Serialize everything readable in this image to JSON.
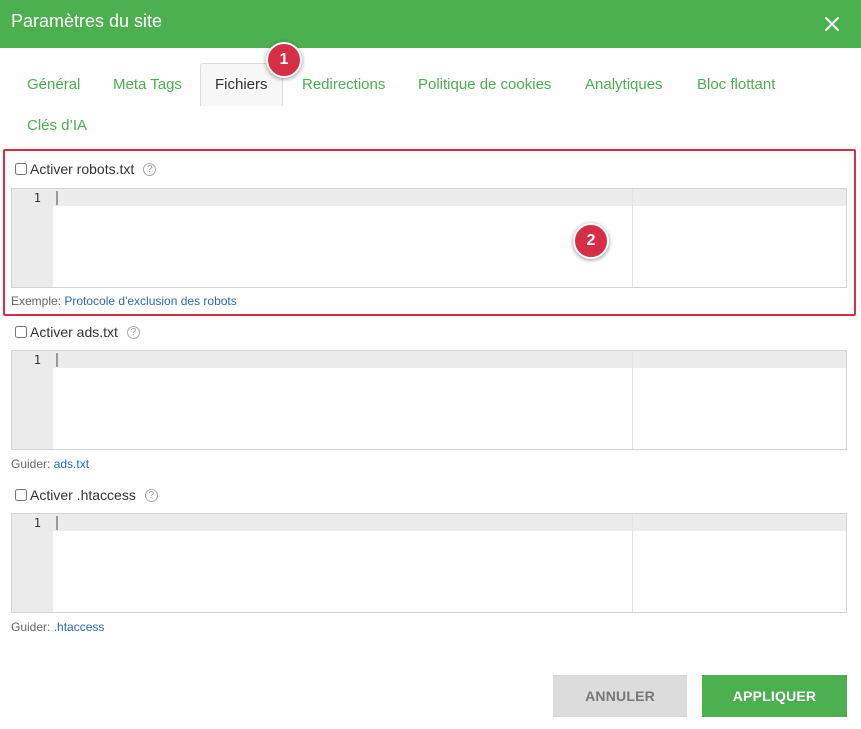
{
  "dialog": {
    "title": "Paramètres du site",
    "close_icon": "close-icon"
  },
  "tabs": [
    {
      "label": "Général"
    },
    {
      "label": "Meta Tags"
    },
    {
      "label": "Fichiers"
    },
    {
      "label": "Redirections"
    },
    {
      "label": "Politique de cookies"
    },
    {
      "label": "Analytiques"
    },
    {
      "label": "Bloc flottant"
    },
    {
      "label": "Clés d’IA"
    }
  ],
  "active_tab": "Fichiers",
  "annotations": [
    "1",
    "2"
  ],
  "sections": {
    "robots": {
      "checkbox_label": "Activer robots.txt",
      "checked": false,
      "line_number": "1",
      "hint_prefix": "Exemple:",
      "hint_link": "Protocole d'exclusion des robots"
    },
    "ads": {
      "checkbox_label": "Activer ads.txt",
      "checked": false,
      "line_number": "1",
      "hint_prefix": "Guider:",
      "hint_link": "ads.txt"
    },
    "htaccess": {
      "checkbox_label": "Activer .htaccess",
      "checked": false,
      "line_number": "1",
      "hint_prefix": "Guider:",
      "hint_link": ".htaccess"
    }
  },
  "buttons": {
    "cancel": "ANNULER",
    "apply": "APPLIQUER"
  },
  "colors": {
    "primary": "#4caf50",
    "annotation": "#d62f45",
    "link": "#2a6ab8"
  }
}
